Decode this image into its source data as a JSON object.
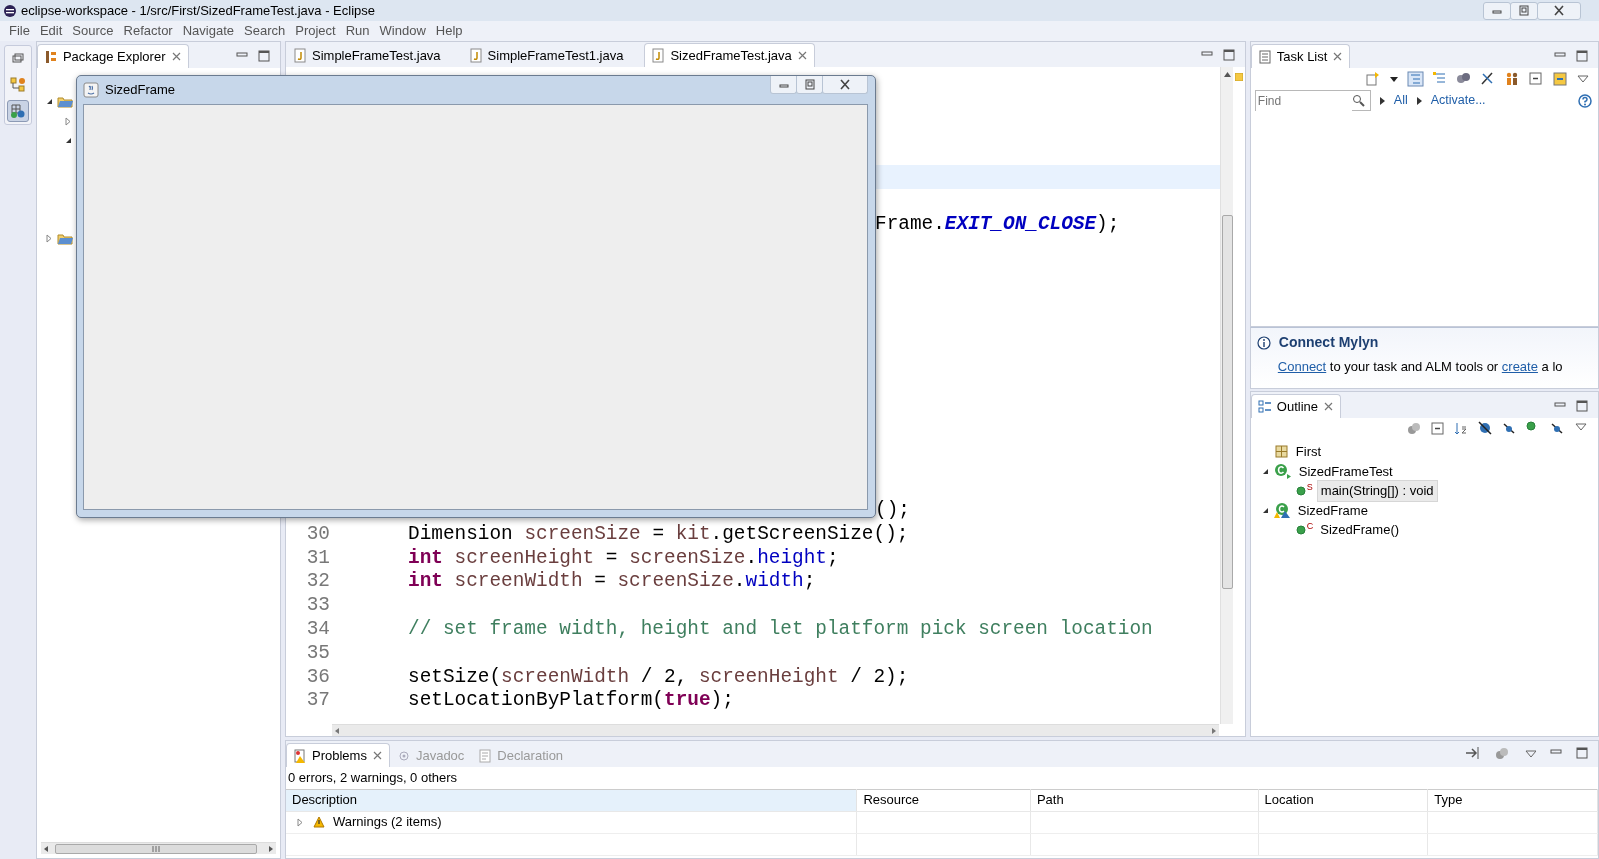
{
  "window": {
    "title": "eclipse-workspace - 1/src/First/SizedFrameTest.java - Eclipse"
  },
  "menu": [
    "File",
    "Edit",
    "Source",
    "Refactor",
    "Navigate",
    "Search",
    "Project",
    "Run",
    "Window",
    "Help"
  ],
  "package_explorer": {
    "title": "Package Explorer",
    "items": [
      {
        "expanded": true,
        "children": [
          {
            "expanded": false
          },
          {
            "expanded": true
          }
        ]
      },
      {
        "expanded": false
      }
    ]
  },
  "editor": {
    "tabs": [
      {
        "label": "SimpleFrameTest.java",
        "selected": false
      },
      {
        "label": "SimpleFrameTest1.java",
        "selected": false
      },
      {
        "label": "SizedFrameTest.java",
        "selected": true
      }
    ],
    "rows": [
      {
        "kind": "covered"
      },
      {
        "kind": "covered"
      },
      {
        "kind": "covered"
      },
      {
        "kind": "covered"
      },
      {
        "kind": "current"
      },
      {
        "kind": "covered"
      },
      {
        "kind": "fragment",
        "segments": [
          {
            "kind": "plain",
            "text": "Frame."
          },
          {
            "kind": "constant",
            "text": "EXIT_ON_CLOSE"
          },
          {
            "kind": "plain",
            "text": ");"
          }
        ]
      },
      {
        "kind": "covered"
      },
      {
        "kind": "covered"
      },
      {
        "kind": "covered"
      },
      {
        "kind": "covered"
      },
      {
        "kind": "covered"
      },
      {
        "kind": "covered"
      },
      {
        "kind": "covered"
      },
      {
        "kind": "covered"
      },
      {
        "kind": "covered"
      },
      {
        "kind": "covered"
      },
      {
        "kind": "covered"
      },
      {
        "kind": "fragment",
        "segments": [
          {
            "kind": "plain",
            "text": "();"
          }
        ]
      },
      {
        "kind": "line",
        "number": "30",
        "segments": [
          {
            "kind": "plain",
            "text": "Dimension "
          },
          {
            "kind": "local",
            "text": "screenSize"
          },
          {
            "kind": "plain",
            "text": " = "
          },
          {
            "kind": "local",
            "text": "kit"
          },
          {
            "kind": "plain",
            "text": ".getScreenSize();"
          }
        ]
      },
      {
        "kind": "line",
        "number": "31",
        "segments": [
          {
            "kind": "keyword",
            "text": "int"
          },
          {
            "kind": "local",
            "text": " screenHeight"
          },
          {
            "kind": "plain",
            "text": " = "
          },
          {
            "kind": "local",
            "text": "screenSize"
          },
          {
            "kind": "plain",
            "text": "."
          },
          {
            "kind": "field",
            "text": "height"
          },
          {
            "kind": "plain",
            "text": ";"
          }
        ]
      },
      {
        "kind": "line",
        "number": "32",
        "segments": [
          {
            "kind": "keyword",
            "text": "int"
          },
          {
            "kind": "local",
            "text": " screenWidth"
          },
          {
            "kind": "plain",
            "text": " = "
          },
          {
            "kind": "local",
            "text": "screenSize"
          },
          {
            "kind": "plain",
            "text": "."
          },
          {
            "kind": "field",
            "text": "width"
          },
          {
            "kind": "plain",
            "text": ";"
          }
        ]
      },
      {
        "kind": "line",
        "number": "33"
      },
      {
        "kind": "line",
        "number": "34",
        "segments": [
          {
            "kind": "comment",
            "text": "// set frame width, height and let platform pick screen location"
          }
        ]
      },
      {
        "kind": "line",
        "number": "35"
      },
      {
        "kind": "line",
        "number": "36",
        "segments": [
          {
            "kind": "plain",
            "text": "setSize("
          },
          {
            "kind": "local",
            "text": "screenWidth"
          },
          {
            "kind": "plain",
            "text": " / 2, "
          },
          {
            "kind": "local",
            "text": "screenHeight"
          },
          {
            "kind": "plain",
            "text": " / 2);"
          }
        ]
      },
      {
        "kind": "line",
        "number": "37",
        "segments": [
          {
            "kind": "plain",
            "text": "setLocationByPlatform("
          },
          {
            "kind": "keyword",
            "text": "true"
          },
          {
            "kind": "plain",
            "text": ");"
          }
        ]
      }
    ]
  },
  "frame_window": {
    "title": "SizedFrame"
  },
  "task_list": {
    "title": "Task List",
    "search": {
      "placeholder": "Find"
    },
    "links": [
      "All",
      "Activate..."
    ]
  },
  "connect_mylyn": {
    "title": "Connect Mylyn",
    "text": [
      {
        "text": "Connect",
        "link": true
      },
      {
        "text": " to your task and ALM tools or ",
        "link": false
      },
      {
        "text": "create",
        "link": true
      },
      {
        "text": " a lo",
        "link": false
      }
    ]
  },
  "outline": {
    "title": "Outline",
    "items": [
      {
        "kind": "package",
        "label": "First",
        "selected": false
      },
      {
        "kind": "class",
        "label": "SizedFrameTest",
        "selected": false,
        "expanded": true,
        "children": [
          {
            "kind": "method",
            "label": "main(String[]) : void",
            "marker": "S",
            "selected": true
          }
        ]
      },
      {
        "kind": "frameclass",
        "label": "SizedFrame",
        "selected": false,
        "expanded": true,
        "children": [
          {
            "kind": "method",
            "label": "SizedFrame()",
            "marker": "C",
            "selected": false
          }
        ]
      }
    ]
  },
  "problems": {
    "tabs": [
      {
        "label": "Problems",
        "selected": true
      },
      {
        "label": "Javadoc",
        "selected": false
      },
      {
        "label": "Declaration",
        "selected": false
      }
    ],
    "summary": "0 errors, 2 warnings, 0 others",
    "columns": [
      {
        "label": "Description",
        "sorted": true
      },
      {
        "label": "Resource",
        "sorted": false
      },
      {
        "label": "Path",
        "sorted": false
      },
      {
        "label": "Location",
        "sorted": false
      },
      {
        "label": "Type",
        "sorted": false
      }
    ],
    "rows": [
      {
        "label": "Warnings (2 items)",
        "expanded": false
      }
    ]
  }
}
